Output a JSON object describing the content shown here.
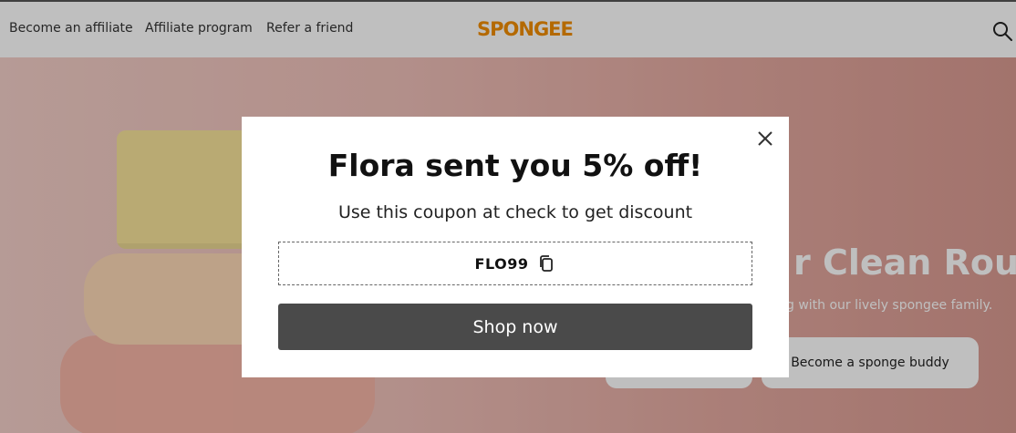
{
  "header": {
    "nav": [
      "Become an affiliate",
      "Affiliate program",
      "Refer a friend"
    ],
    "logo": "SPONGEE",
    "search_icon": "search-icon"
  },
  "hero": {
    "title_visible": "r Clean Routi",
    "subtitle_visible": "g with our lively spongee family.",
    "button_a": "",
    "button_b": "Become a sponge buddy"
  },
  "modal": {
    "title": "Flora sent you 5% off!",
    "subtitle": "Use this coupon at check to get discount",
    "coupon_code": "FLO99",
    "copy_icon": "copy-icon",
    "close_icon": "close-icon",
    "cta": "Shop now"
  },
  "colors": {
    "logo": "#f08c00",
    "cta_bg": "#4a4a4a",
    "overlay": "rgba(0,0,0,0.25)"
  }
}
